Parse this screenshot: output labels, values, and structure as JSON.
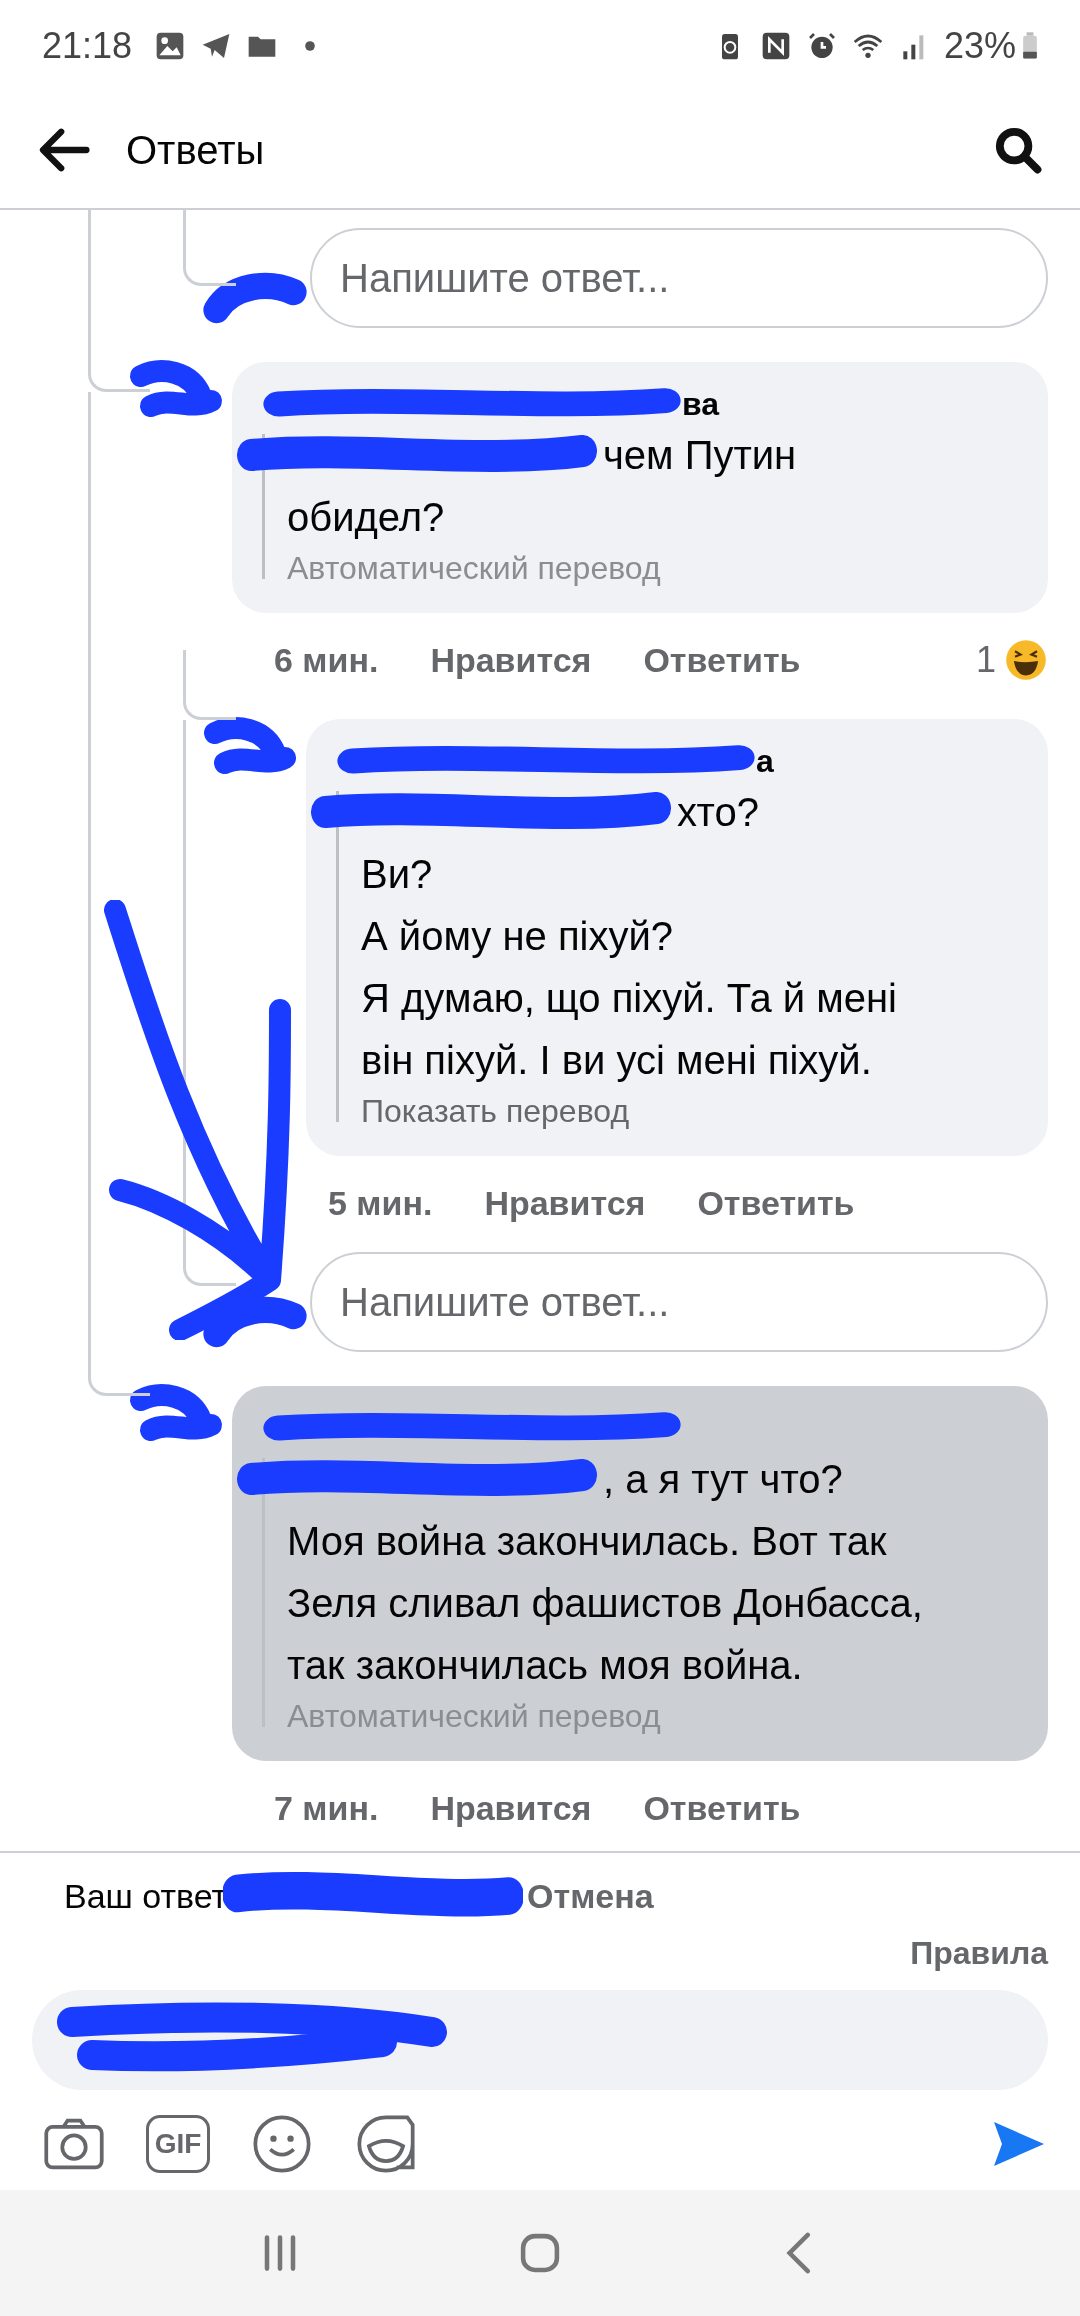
{
  "status_bar": {
    "time": "21:18",
    "battery": "23%"
  },
  "header": {
    "title": "Ответы"
  },
  "thread": [
    {
      "kind": "continuation",
      "children": [
        {
          "kind": "reply_field",
          "placeholder": "Напишите ответ..."
        }
      ]
    },
    {
      "kind": "comment",
      "author": "ва",
      "lines": [
        "чем Путин",
        "обидел?"
      ],
      "translation": "Автоматический перевод",
      "auto_translated": true,
      "time": "6 мин.",
      "like": "Нравится",
      "reply": "Ответить",
      "reaction_count": "1",
      "selected": false,
      "children": [
        {
          "kind": "comment",
          "author": "а",
          "lines": [
            "хто?",
            "Ви?",
            "А йому не піхуй?",
            "Я думаю, що піхуй. Та й мені",
            "він піхуй. І ви усі мені піхуй."
          ],
          "translation": "Показать перевод",
          "auto_translated": false,
          "time": "5 мин.",
          "like": "Нравится",
          "reply": "Ответить",
          "selected": false
        },
        {
          "kind": "reply_field",
          "placeholder": "Напишите ответ..."
        }
      ]
    },
    {
      "kind": "comment",
      "lines": [
        ", а я тут что?",
        "Моя война закончилась. Вот так",
        "Зеля сливал фашистов Донбасса,",
        "так закончилась моя война."
      ],
      "translation": "Автоматический перевод",
      "auto_translated": true,
      "time": "7 мин.",
      "like": "Нравится",
      "reply": "Ответить",
      "selected": true
    }
  ],
  "composer": {
    "replying_to": "Ваш ответ",
    "cancel": "Отмена",
    "rules": "Правила",
    "gif_label": "GIF"
  }
}
